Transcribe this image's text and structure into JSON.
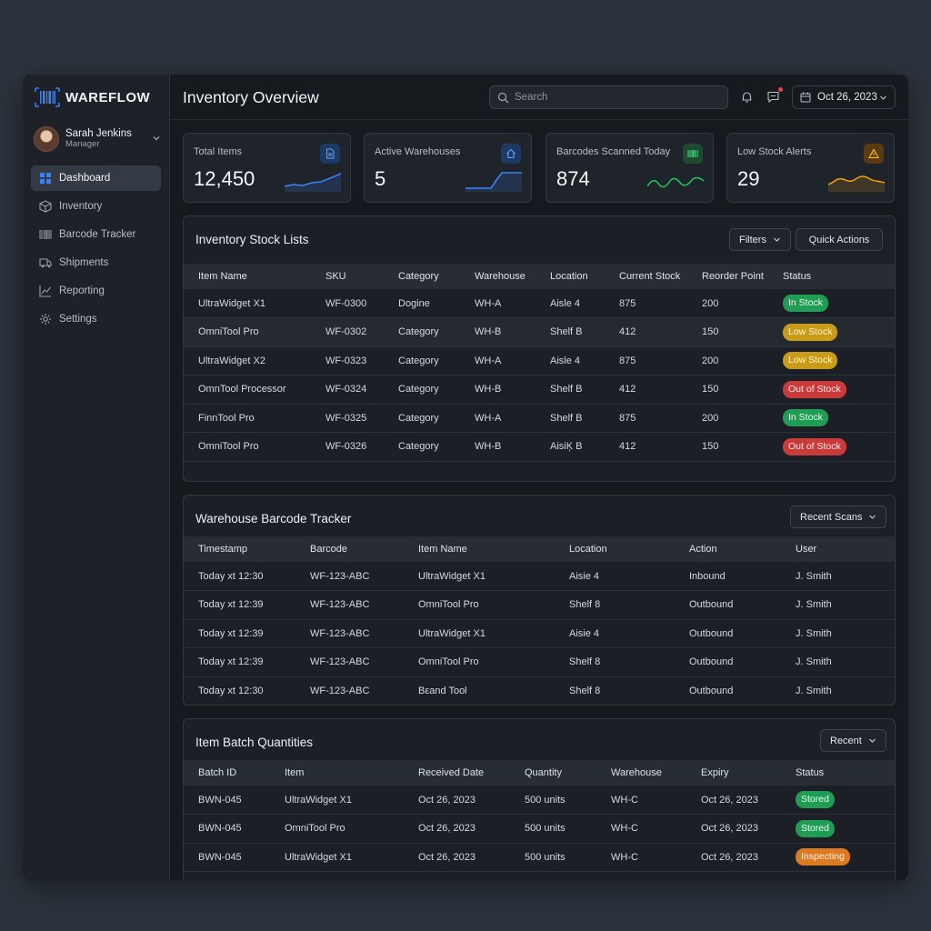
{
  "app": {
    "logo_text": "WAREFLOW"
  },
  "user": {
    "name": "Sarah Jenkins",
    "role": "Manager"
  },
  "sidebar": {
    "items": [
      {
        "label": "Dashboard",
        "icon": "dashboard-icon",
        "active": true
      },
      {
        "label": "Inventory",
        "icon": "box-icon"
      },
      {
        "label": "Barcode Tracker",
        "icon": "barcode-icon"
      },
      {
        "label": "Shipments",
        "icon": "truck-icon"
      },
      {
        "label": "Reporting",
        "icon": "chart-icon"
      },
      {
        "label": "Settings",
        "icon": "gear-icon"
      }
    ]
  },
  "header": {
    "title": "Inventory Overview",
    "search_placeholder": "Search",
    "date": "Oct 26, 2023"
  },
  "stats": [
    {
      "label": "Total Items",
      "value": "12,450",
      "icon": "document-icon",
      "color": "#3b82f6"
    },
    {
      "label": "Active Warehouses",
      "value": "5",
      "icon": "home-icon",
      "color": "#3b82f6"
    },
    {
      "label": "Barcodes Scanned Today",
      "value": "874",
      "icon": "barcode-icon",
      "color": "#22c55e"
    },
    {
      "label": "Low Stock Alerts",
      "value": "29",
      "icon": "warning-icon",
      "color": "#f59e0b"
    }
  ],
  "stock": {
    "title": "Inventory Stock Lists",
    "filters_label": "Filters",
    "quick_actions_label": "Quick Actions",
    "columns": [
      "Item Name",
      "SKU",
      "Category",
      "Warehouse",
      "Location",
      "Current Stock",
      "Reorder Point",
      "Status"
    ],
    "rows": [
      [
        "UltraWidget X1",
        "WF-0300",
        "Dogine",
        "WH-A",
        "Aisle 4",
        "875",
        "200",
        "In Stock"
      ],
      [
        "OmniTool Pro",
        "WF-0302",
        "Category",
        "WH-B",
        "Shelf B",
        "412",
        "150",
        "Low Stock"
      ],
      [
        "UltraWidget X2",
        "WF-0323",
        "Category",
        "WH-A",
        "Aisle 4",
        "875",
        "200",
        "Low Stock"
      ],
      [
        "OmnTool Processor",
        "WF-0324",
        "Category",
        "WH-B",
        "Shelf B",
        "412",
        "150",
        "Out of Stock"
      ],
      [
        "FinnTool Pro",
        "WF-0325",
        "Category",
        "WH-A",
        "Shelf B",
        "875",
        "200",
        "In Stock"
      ],
      [
        "OmniTool Pro",
        "WF-0326",
        "Category",
        "WH-B",
        "AisiĶ B",
        "412",
        "150",
        "Out of Stock"
      ]
    ]
  },
  "tracker": {
    "title": "Warehouse Barcode Tracker",
    "filter_label": "Recent Scans",
    "columns": [
      "Timestamp",
      "Barcode",
      "Item Name",
      "Location",
      "Action",
      "User"
    ],
    "rows": [
      [
        "Today хt 12:30",
        "WF-123-ABC",
        "UltraWidget X1",
        "Aisie 4",
        "Inbound",
        "J. Smith"
      ],
      [
        "Today хt 12:39",
        "WF-123-ABC",
        "OmniTool Pro",
        "Shelf 8",
        "Outbound",
        "J. Smith"
      ],
      [
        "Today хt 12:39",
        "WF-123-ABC",
        "UltraWidget X1",
        "Aisie 4",
        "Outbound",
        "J. Smith"
      ],
      [
        "Today хt 12:39",
        "WF-123-ABC",
        "OmniTool Pro",
        "Shelf 8",
        "Outbound",
        "J. Smith"
      ],
      [
        "Today хt 12:30",
        "WF-123-ABC",
        "Bεand Tool",
        "Shelf 8",
        "Outbound",
        "J. Smith"
      ]
    ]
  },
  "batch": {
    "title": "Item Batch Quantities",
    "filter_label": "Recent",
    "columns": [
      "Batch ID",
      "Item",
      "Received Date",
      "Quantity",
      "Warehouse",
      "Expiry",
      "Status"
    ],
    "rows": [
      [
        "BWN-045",
        "UltraWidget X1",
        "Oct 26, 2023",
        "500 units",
        "WH-C",
        "Oct 26, 2023",
        "Stored"
      ],
      [
        "BWN-045",
        "OmniTool Pro",
        "Oct 26, 2023",
        "500 units",
        "WH-C",
        "Oct 26, 2023",
        "Stored"
      ],
      [
        "BWN-045",
        "UltraWidget X1",
        "Oct 26, 2023",
        "500 units",
        "WH-C",
        "Oct 26, 2023",
        "Inspecting"
      ]
    ]
  },
  "status_colors": {
    "In Stock": "green",
    "Low Stock": "yellow",
    "Out of Stock": "red",
    "Stored": "green",
    "Inspecting": "orange"
  }
}
